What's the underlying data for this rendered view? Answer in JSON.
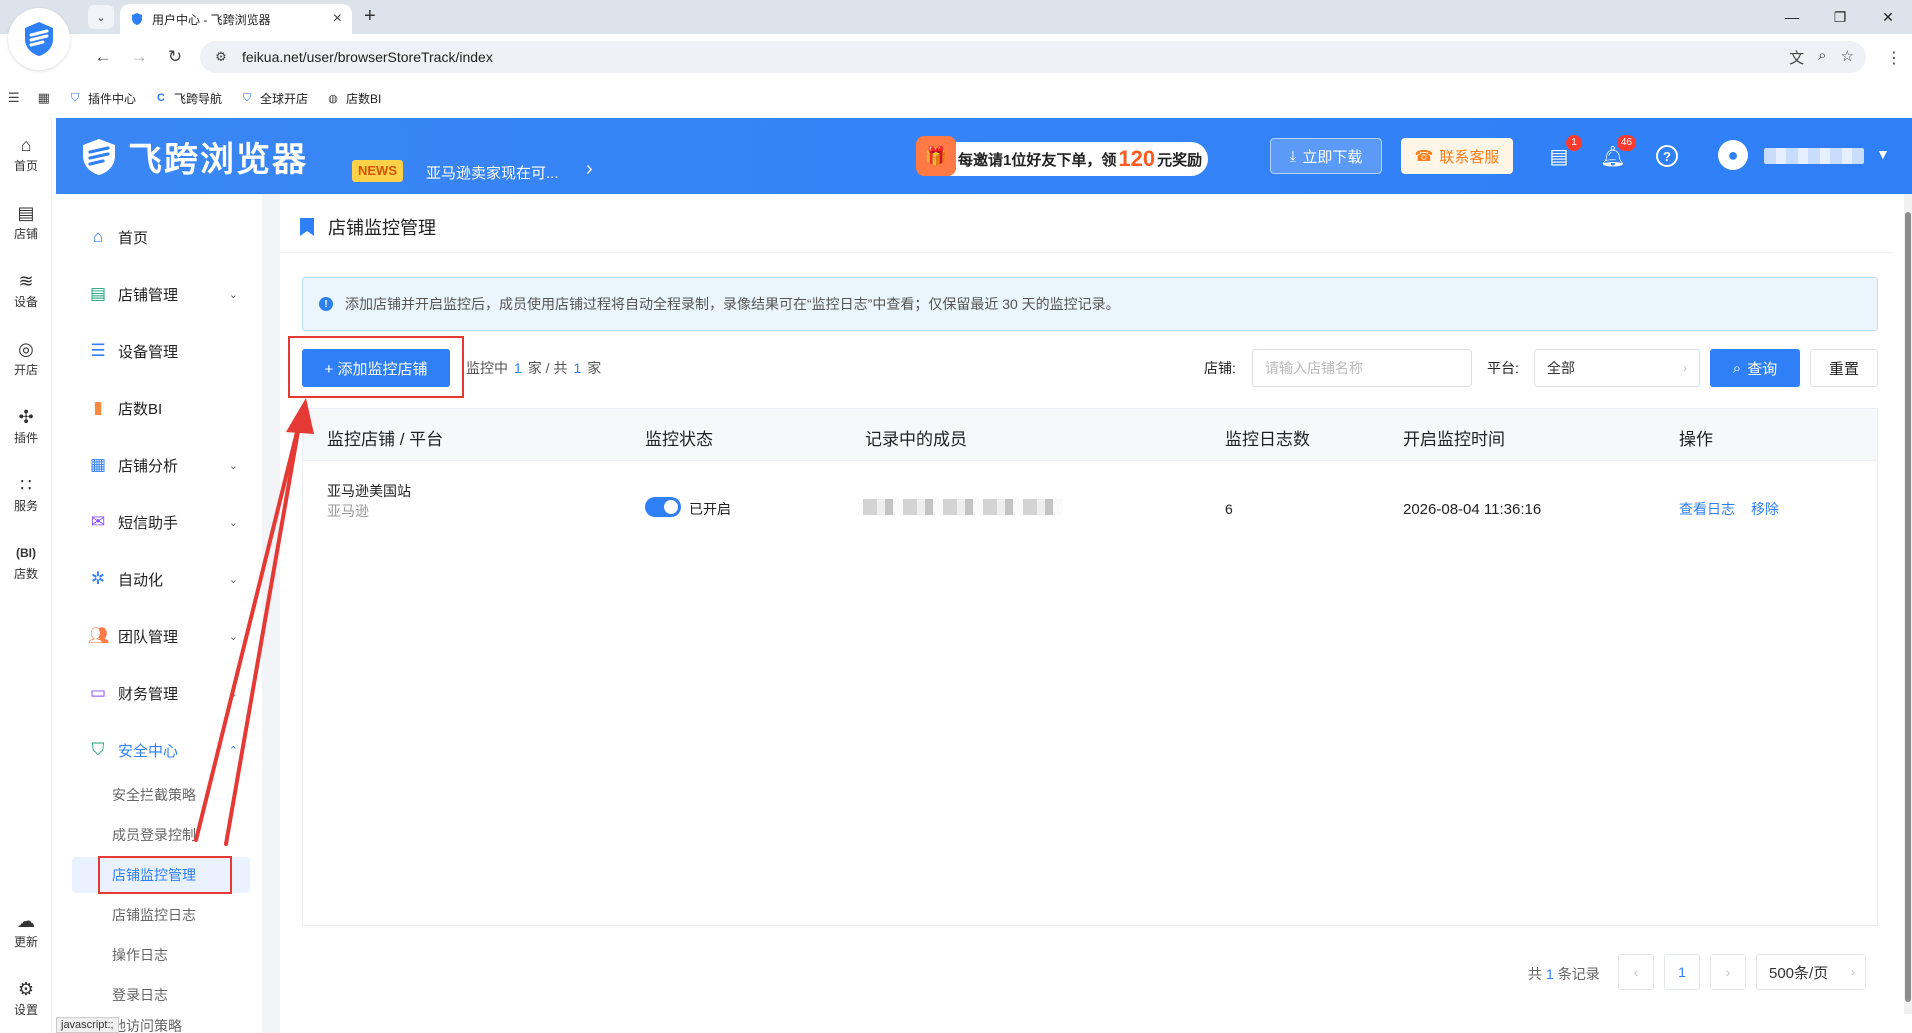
{
  "browser": {
    "tab_title": "用户中心 - 飞跨浏览器",
    "url": "feikua.net/user/browserStoreTrack/index",
    "bookmarks": [
      "插件中心",
      "飞跨导航",
      "全球开店",
      "店数BI"
    ]
  },
  "rail": {
    "items": [
      "首页",
      "店铺",
      "设备",
      "开店",
      "插件",
      "服务",
      "店数",
      "更新",
      "设置"
    ]
  },
  "header": {
    "logo": "飞跨浏览器",
    "news_badge": "NEWS",
    "news_text": "亚马逊卖家现在可...",
    "invite_prefix": "每邀请1位好友下单，领",
    "invite_amount": "120",
    "invite_suffix": "元奖励",
    "download_label": "立即下载",
    "contact_label": "联系客服",
    "messages_badge": "1",
    "notifications_badge": "46"
  },
  "sidebar": {
    "items": [
      {
        "label": "首页"
      },
      {
        "label": "店铺管理"
      },
      {
        "label": "设备管理"
      },
      {
        "label": "店数BI"
      },
      {
        "label": "店铺分析"
      },
      {
        "label": "短信助手"
      },
      {
        "label": "自动化"
      },
      {
        "label": "团队管理"
      },
      {
        "label": "财务管理"
      },
      {
        "label": "安全中心"
      }
    ],
    "sub_items": [
      "安全拦截策略",
      "成员登录控制",
      "店铺监控管理",
      "店铺监控日志",
      "操作日志",
      "登录日志",
      "地访问策略"
    ]
  },
  "main": {
    "page_title": "店铺监控管理",
    "alert": "添加店铺并开启监控后，成员使用店铺过程将自动全程录制，录像结果可在“监控日志”中查看；仅保留最近 30 天的监控记录。",
    "add_button": "+ 添加监控店铺",
    "count_prefix": "监控中",
    "count_monitoring": "1",
    "count_mid": "家 / 共",
    "count_total": "1",
    "count_suffix": "家",
    "filter_store_label": "店铺:",
    "filter_store_placeholder": "请输入店铺名称",
    "filter_platform_label": "平台:",
    "filter_platform_value": "全部",
    "query_label": "查询",
    "reset_label": "重置"
  },
  "table": {
    "columns": [
      "监控店铺 / 平台",
      "监控状态",
      "记录中的成员",
      "监控日志数",
      "开启监控时间",
      "操作"
    ],
    "rows": [
      {
        "store": "亚马逊美国站",
        "platform": "亚马逊",
        "status": "已开启",
        "log_count": "6",
        "start_time": "2026-08-04 11:36:16",
        "action_view": "查看日志",
        "action_remove": "移除"
      }
    ]
  },
  "pager": {
    "total_prefix": "共",
    "total": "1",
    "total_suffix": "条记录",
    "current_page": "1",
    "page_size": "500条/页"
  },
  "status_tip": "javascript:;",
  "colors": {
    "primary": "#2f7ff7",
    "highlight": "#e53935"
  }
}
